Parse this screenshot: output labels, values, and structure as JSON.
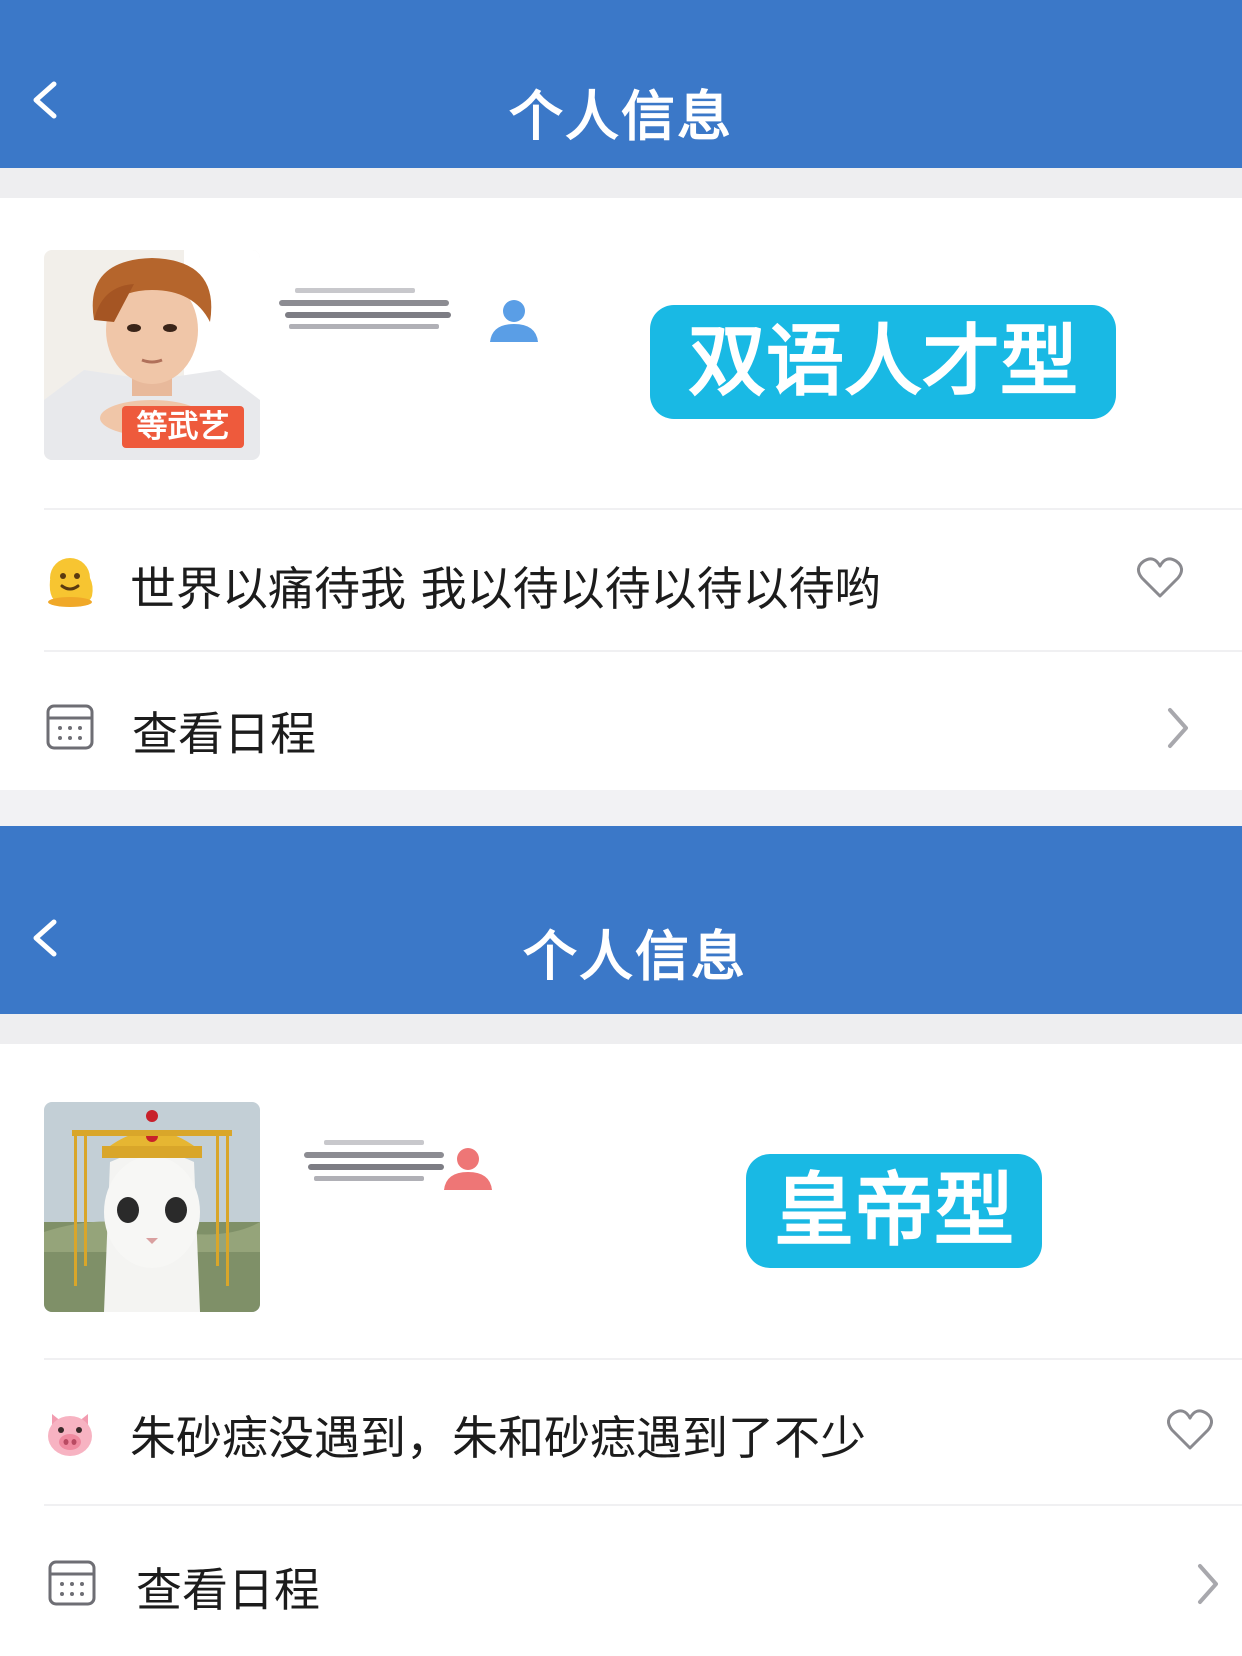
{
  "screens": [
    {
      "nav": {
        "back_icon": "chevron-left-icon",
        "title": "个人信息"
      },
      "profile": {
        "avatar_caption": "等武艺",
        "user_icon_color": "#5a9ee6",
        "tag": "双语人才型"
      },
      "status": {
        "emoji": "melting-face-emoji",
        "text": "世界以痛待我 我以待以待以待以待哟"
      },
      "schedule": {
        "label": "查看日程"
      }
    },
    {
      "nav": {
        "back_icon": "chevron-left-icon",
        "title": "个人信息"
      },
      "profile": {
        "user_icon_color": "#ee7676",
        "tag": "皇帝型"
      },
      "status": {
        "emoji": "pig-face-emoji",
        "text": "朱砂痣没遇到，朱和砂痣遇到了不少"
      },
      "schedule": {
        "label": "查看日程"
      }
    }
  ],
  "colors": {
    "nav_bg": "#3b78c8",
    "tag_bg": "#19b9e4"
  }
}
